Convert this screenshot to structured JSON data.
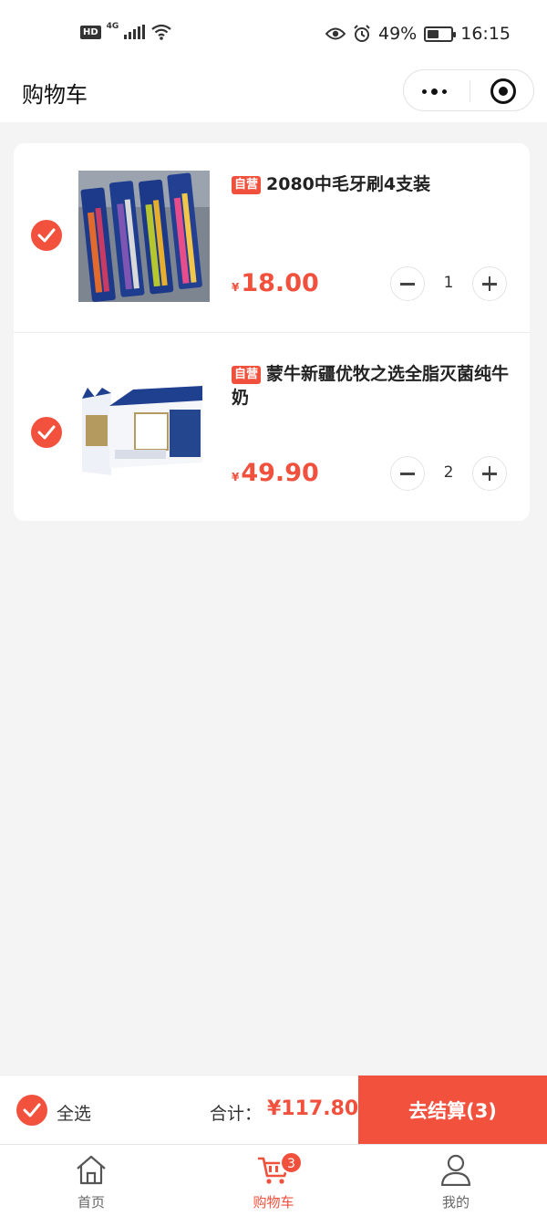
{
  "status_bar": {
    "hd": "HD",
    "network": "4G",
    "battery_percent": "49%",
    "battery_level": 0.49,
    "time": "16:15",
    "icons": [
      "signal-icon",
      "wifi-icon",
      "eye-icon",
      "alarm-icon",
      "battery-icon"
    ]
  },
  "nav": {
    "title": "购物车",
    "more_icon": "more-dots-icon",
    "close_icon": "target-icon"
  },
  "cart": {
    "items": [
      {
        "tag": "自营",
        "title": "2080中毛牙刷4支装",
        "currency": "¥",
        "price": "18.00",
        "quantity": "1",
        "checked": true
      },
      {
        "tag": "自营",
        "title": "蒙牛新疆优牧之选全脂灭菌纯牛奶",
        "currency": "¥",
        "price": "49.90",
        "quantity": "2",
        "checked": true
      }
    ]
  },
  "footer": {
    "select_all_label": "全选",
    "total_label": "合计：",
    "total_value": "¥117.80",
    "checkout_label": "去结算(3)"
  },
  "tabbar": {
    "tabs": [
      {
        "label": "首页",
        "icon": "home-icon"
      },
      {
        "label": "购物车",
        "icon": "cart-icon",
        "badge": "3",
        "active": true
      },
      {
        "label": "我的",
        "icon": "user-icon"
      }
    ]
  },
  "colors": {
    "accent": "#f0503c",
    "background": "#f4f4f4"
  }
}
